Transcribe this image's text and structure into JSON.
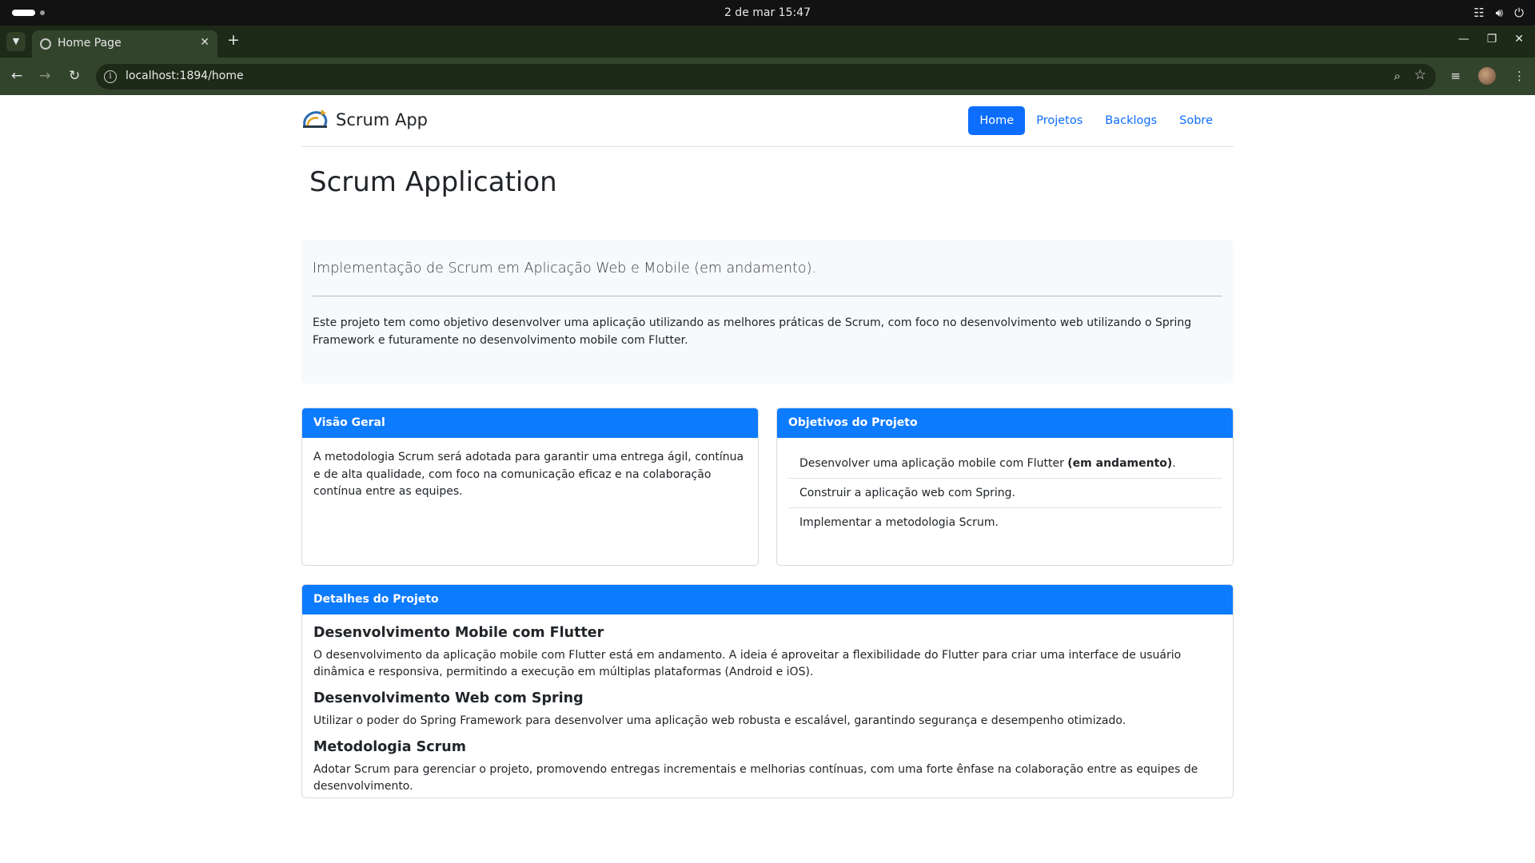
{
  "os": {
    "clock": "2 de mar  15:47"
  },
  "browser": {
    "tab_title": "Home Page",
    "url": "localhost:1894/home"
  },
  "navbar": {
    "brand": "Scrum App",
    "links": [
      {
        "label": "Home",
        "active": true
      },
      {
        "label": "Projetos",
        "active": false
      },
      {
        "label": "Backlogs",
        "active": false
      },
      {
        "label": "Sobre",
        "active": false
      }
    ]
  },
  "main": {
    "title": "Scrum Application",
    "lead": "Implementação de Scrum em Aplicação Web e Mobile (em andamento).",
    "intro": "Este projeto tem como objetivo desenvolver uma aplicação utilizando as melhores práticas de Scrum, com foco no desenvolvimento web utilizando o Spring Framework e futuramente no desenvolvimento mobile com Flutter."
  },
  "visao_geral": {
    "header": "Visão Geral",
    "text": "A metodologia Scrum será adotada para garantir uma entrega ágil, contínua e de alta qualidade, com foco na comunicação eficaz e na colaboração contínua entre as equipes."
  },
  "objetivos": {
    "header": "Objetivos do Projeto",
    "item1_prefix": "Desenvolver uma aplicação mobile com Flutter ",
    "item1_bold": "(em andamento)",
    "item1_suffix": ".",
    "item2": "Construir a aplicação web com Spring.",
    "item3": "Implementar a metodologia Scrum."
  },
  "detalhes": {
    "header": "Detalhes do Projeto",
    "sections": [
      {
        "title": "Desenvolvimento Mobile com Flutter",
        "text": "O desenvolvimento da aplicação mobile com Flutter está em andamento. A ideia é aproveitar a flexibilidade do Flutter para criar uma interface de usuário dinâmica e responsiva, permitindo a execução em múltiplas plataformas (Android e iOS)."
      },
      {
        "title": "Desenvolvimento Web com Spring",
        "text": "Utilizar o poder do Spring Framework para desenvolver uma aplicação web robusta e escalável, garantindo segurança e desempenho otimizado."
      },
      {
        "title": "Metodologia Scrum",
        "text": "Adotar Scrum para gerenciar o projeto, promovendo entregas incrementais e melhorias contínuas, com uma forte ênfase na colaboração entre as equipes de desenvolvimento."
      }
    ]
  },
  "colors": {
    "primary": "#0d6efd",
    "card_header": "#0d7bfe",
    "browser_frame": "#33442c"
  }
}
